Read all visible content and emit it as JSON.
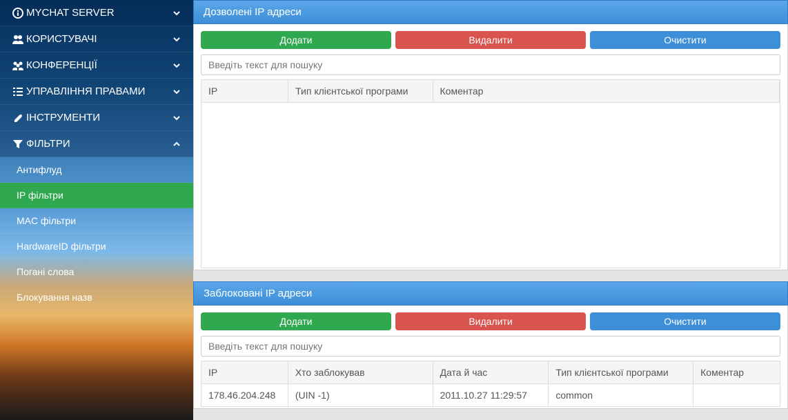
{
  "sidebar": {
    "sections": [
      {
        "label": "MYCHAT SERVER",
        "expanded": false
      },
      {
        "label": "КОРИСТУВАЧІ",
        "expanded": false
      },
      {
        "label": "КОНФЕРЕНЦІЇ",
        "expanded": false
      },
      {
        "label": "УПРАВЛІННЯ ПРАВАМИ",
        "expanded": false
      },
      {
        "label": "ІНСТРУМЕНТИ",
        "expanded": false
      },
      {
        "label": "ФІЛЬТРИ",
        "expanded": true
      }
    ],
    "filters_subitems": [
      {
        "label": "Антифлуд",
        "active": false
      },
      {
        "label": "IP фільтри",
        "active": true
      },
      {
        "label": "MAC фільтри",
        "active": false
      },
      {
        "label": "HardwareID фільтри",
        "active": false
      },
      {
        "label": "Погані слова",
        "active": false
      },
      {
        "label": "Блокування назв",
        "active": false
      }
    ]
  },
  "buttons": {
    "add": "Додати",
    "delete": "Видалити",
    "clear": "Очистити"
  },
  "search_placeholder": "Введіть текст для пошуку",
  "allowed_panel": {
    "title": "Дозволені IP адреси",
    "columns": {
      "ip": "IP",
      "client_type": "Тип клієнтської програми",
      "comment": "Коментар"
    }
  },
  "blocked_panel": {
    "title": "Заблоковані IP адреси",
    "columns": {
      "ip": "IP",
      "blocked_by": "Хто заблокував",
      "datetime": "Дата й час",
      "client_type": "Тип клієнтської програми",
      "comment": "Коментар"
    },
    "rows": [
      {
        "ip": "178.46.204.248",
        "blocked_by": "(UIN -1)",
        "datetime": "2011.10.27 11:29:57",
        "client_type": "common",
        "comment": ""
      }
    ]
  }
}
